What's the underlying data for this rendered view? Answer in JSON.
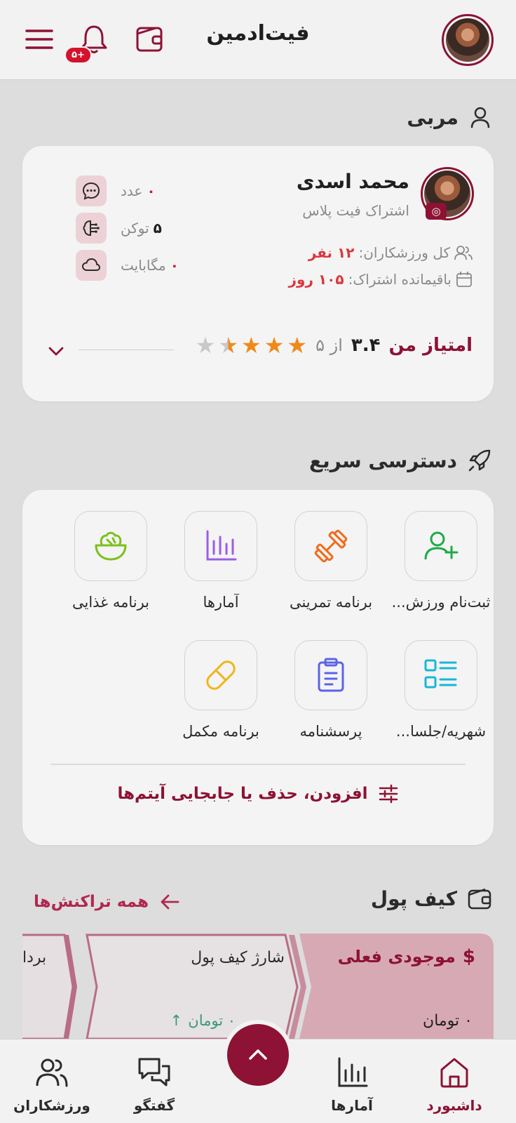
{
  "header": {
    "title": "فیت‌ادمین",
    "notification_badge": "+۵"
  },
  "coach_section": {
    "title": "مربی",
    "name": "محمد اسدی",
    "subscription": "اشتراک فیت پلاس",
    "athletes_label": "کل ورزشکاران:",
    "athletes_value": "۱۲ نفر",
    "remaining_label": "باقیمانده اشتراک:",
    "remaining_value": "۱۰۵ روز",
    "stats": [
      {
        "value": "۰",
        "unit": "عدد",
        "icon": "chat-icon"
      },
      {
        "value": "۵",
        "unit": "توکن",
        "icon": "ai-brain-icon"
      },
      {
        "value": "۰",
        "unit": "مگابایت",
        "icon": "cloud-icon"
      }
    ],
    "rating_label": "امتیاز من",
    "rating_value": "۳.۴",
    "rating_of": "از ۵",
    "rating_numeric": 3.4
  },
  "quick_access": {
    "title": "دسترسی سریع",
    "items": [
      {
        "label": "ثبت‌نام ورزش...",
        "icon": "user-plus-icon",
        "color": "#1faa4b"
      },
      {
        "label": "برنامه تمرینی",
        "icon": "dumbbell-icon",
        "color": "#f26b1d"
      },
      {
        "label": "آمارها",
        "icon": "bar-chart-icon",
        "color": "#9b5de5"
      },
      {
        "label": "برنامه غذایی",
        "icon": "salad-icon",
        "color": "#7cc11b"
      },
      {
        "label": "شهریه/جلسا...",
        "icon": "list-icon",
        "color": "#18b7d6"
      },
      {
        "label": "پرسشنامه",
        "icon": "clipboard-icon",
        "color": "#5b63e6"
      },
      {
        "label": "برنامه مکمل",
        "icon": "pill-icon",
        "color": "#f0b51a"
      }
    ],
    "edit_label": "افزودن، حذف یا جابجایی آیتم‌ها"
  },
  "wallet": {
    "title": "کیف پول",
    "all_transactions": "همه تراکنش‌ها",
    "current_balance_label": "موجودی فعلی",
    "current_balance_value": "۰ تومان",
    "charge_label": "شارژ کیف پول",
    "charge_value": "۰ تومان",
    "withdraw_label": "بردا"
  },
  "bottom_nav": {
    "items": [
      {
        "label": "داشبورد",
        "icon": "home-icon",
        "active": true
      },
      {
        "label": "آمارها",
        "icon": "bar-chart-icon",
        "active": false
      },
      {
        "label": "گفتگو",
        "icon": "chat-bubbles-icon",
        "active": false
      },
      {
        "label": "ورزشکاران",
        "icon": "users-icon",
        "active": false
      }
    ]
  },
  "colors": {
    "primary": "#8d1233",
    "accent_red": "#d3132c",
    "star": "#f0891a"
  }
}
